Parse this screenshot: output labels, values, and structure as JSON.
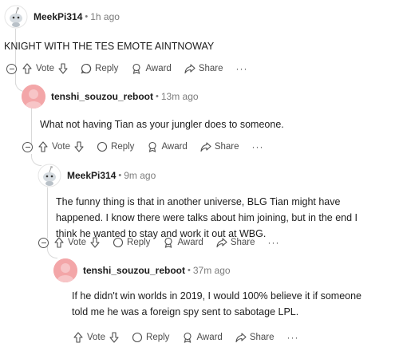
{
  "comments": [
    {
      "author": "MeekPi314",
      "separator": "•",
      "time": "1h ago",
      "body": "KNIGHT WITH THE TES EMOTE AINTNOWAY",
      "actions": {
        "vote": "Vote",
        "reply": "Reply",
        "award": "Award",
        "share": "Share",
        "more": "···"
      }
    },
    {
      "author": "tenshi_souzou_reboot",
      "separator": "•",
      "time": "13m ago",
      "body": "What not having Tian as your jungler does to someone.",
      "actions": {
        "vote": "Vote",
        "reply": "Reply",
        "award": "Award",
        "share": "Share",
        "more": "···"
      }
    },
    {
      "author": "MeekPi314",
      "separator": "•",
      "time": "9m ago",
      "body": "The funny thing is that in another universe, BLG Tian might have happened. I know there were talks about him joining, but in the end I think he wanted to stay and work it out at WBG.",
      "actions": {
        "vote": "Vote",
        "reply": "Reply",
        "award": "Award",
        "share": "Share",
        "more": "···"
      }
    },
    {
      "author": "tenshi_souzou_reboot",
      "separator": "•",
      "time": "37m ago",
      "body": "If he didn't win worlds in 2019, I would 100% believe it if someone told me he was a foreign spy sent to sabotage LPL.",
      "actions": {
        "vote": "Vote",
        "reply": "Reply",
        "award": "Award",
        "share": "Share",
        "more": "···"
      }
    }
  ]
}
